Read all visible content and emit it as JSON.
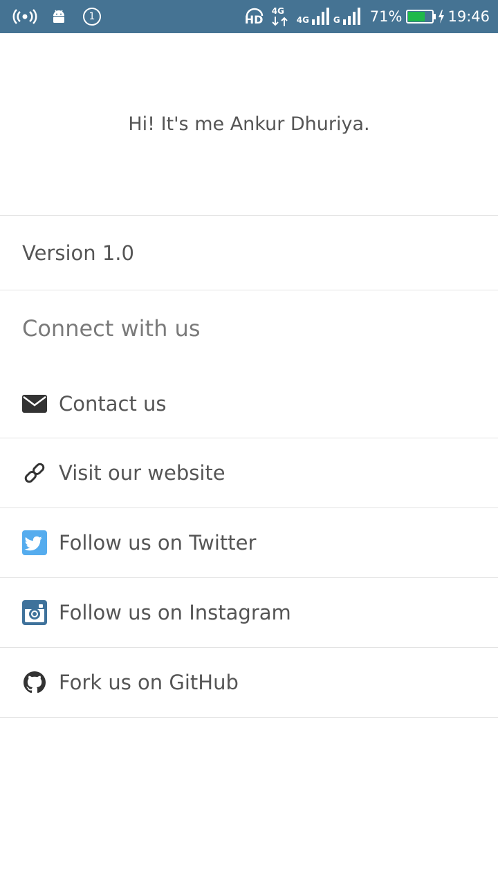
{
  "status_bar": {
    "notification_count": "1",
    "hd_label": "HD",
    "net_4g_top": "4G",
    "net_4g": "4G",
    "net_g": "G",
    "battery_percent": "71%",
    "battery_level": 0.71,
    "time": "19:46",
    "colors": {
      "background": "#457393",
      "battery_fill": "#1fb84a"
    },
    "icons": [
      "hotspot-icon",
      "android-icon",
      "notification-count-icon",
      "hd-voice-icon",
      "data-arrows-icon",
      "signal-icon",
      "signal-icon",
      "battery-icon",
      "charging-icon"
    ]
  },
  "header": {
    "text": "Hi! It's me Ankur Dhuriya."
  },
  "version": {
    "label": "Version 1.0"
  },
  "connect": {
    "title": "Connect with us",
    "items": [
      {
        "label": "Contact us",
        "icon": "envelope-icon"
      },
      {
        "label": "Visit our website",
        "icon": "link-icon"
      },
      {
        "label": "Follow us on Twitter",
        "icon": "twitter-icon",
        "color": "#55acee"
      },
      {
        "label": "Follow us on Instagram",
        "icon": "instagram-icon",
        "color": "#3f729b"
      },
      {
        "label": "Fork us on GitHub",
        "icon": "github-icon"
      }
    ]
  },
  "colors": {
    "text": "#555555",
    "section_title": "#7a7a7a",
    "divider": "#e3e3e3"
  }
}
